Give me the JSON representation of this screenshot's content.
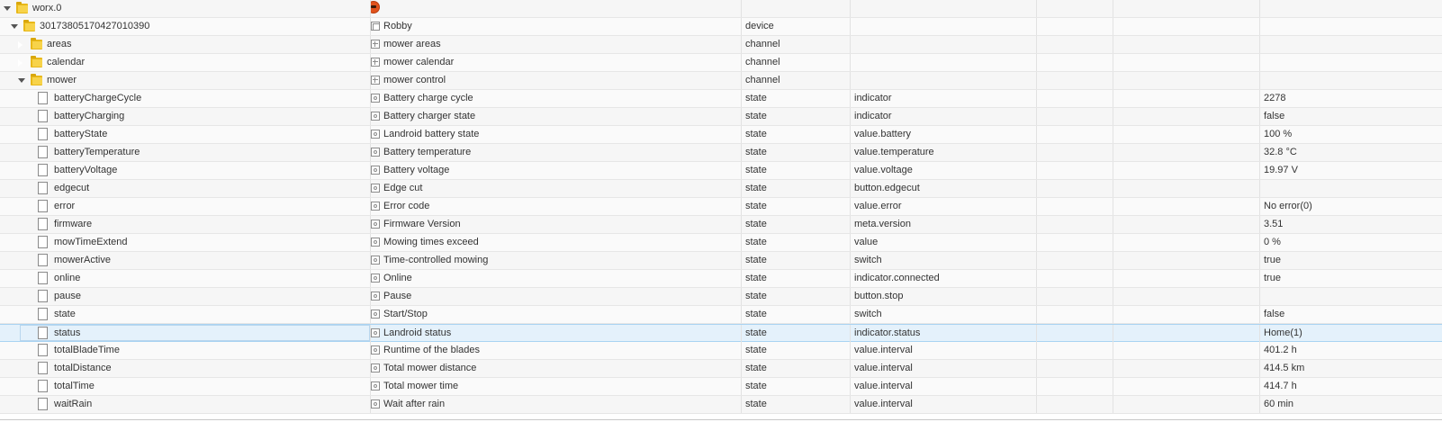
{
  "rows": [
    {
      "id": "worx.0",
      "name": "",
      "type": "",
      "role": "",
      "value": "",
      "level": 0,
      "kind": "folder",
      "twisty": "open",
      "logo": true
    },
    {
      "id": "30173805170427010390",
      "name": "Robby",
      "type": "device",
      "role": "",
      "value": "",
      "level": 1,
      "kind": "folder",
      "twisty": "open",
      "icon": "device"
    },
    {
      "id": "areas",
      "name": "mower areas",
      "type": "channel",
      "role": "",
      "value": "",
      "level": 2,
      "kind": "folder",
      "twisty": "closed",
      "icon": "channel"
    },
    {
      "id": "calendar",
      "name": "mower calendar",
      "type": "channel",
      "role": "",
      "value": "",
      "level": 2,
      "kind": "folder",
      "twisty": "closed",
      "icon": "channel"
    },
    {
      "id": "mower",
      "name": "mower control",
      "type": "channel",
      "role": "",
      "value": "",
      "level": 2,
      "kind": "folder",
      "twisty": "open",
      "icon": "channel"
    },
    {
      "id": "batteryChargeCycle",
      "name": "Battery charge cycle",
      "type": "state",
      "role": "indicator",
      "value": "2278",
      "level": 3,
      "kind": "file",
      "icon": "state"
    },
    {
      "id": "batteryCharging",
      "name": "Battery charger state",
      "type": "state",
      "role": "indicator",
      "value": "false",
      "level": 3,
      "kind": "file",
      "icon": "state"
    },
    {
      "id": "batteryState",
      "name": "Landroid battery state",
      "type": "state",
      "role": "value.battery",
      "value": "100 %",
      "level": 3,
      "kind": "file",
      "icon": "state"
    },
    {
      "id": "batteryTemperature",
      "name": "Battery temperature",
      "type": "state",
      "role": "value.temperature",
      "value": "32.8 °C",
      "level": 3,
      "kind": "file",
      "icon": "state"
    },
    {
      "id": "batteryVoltage",
      "name": "Battery voltage",
      "type": "state",
      "role": "value.voltage",
      "value": "19.97 V",
      "level": 3,
      "kind": "file",
      "icon": "state"
    },
    {
      "id": "edgecut",
      "name": "Edge cut",
      "type": "state",
      "role": "button.edgecut",
      "value": "",
      "level": 3,
      "kind": "file",
      "icon": "state"
    },
    {
      "id": "error",
      "name": "Error code",
      "type": "state",
      "role": "value.error",
      "value": "No error(0)",
      "level": 3,
      "kind": "file",
      "icon": "state"
    },
    {
      "id": "firmware",
      "name": "Firmware Version",
      "type": "state",
      "role": "meta.version",
      "value": "3.51",
      "level": 3,
      "kind": "file",
      "icon": "state"
    },
    {
      "id": "mowTimeExtend",
      "name": "Mowing times exceed",
      "type": "state",
      "role": "value",
      "value": "0 %",
      "level": 3,
      "kind": "file",
      "icon": "state"
    },
    {
      "id": "mowerActive",
      "name": "Time-controlled mowing",
      "type": "state",
      "role": "switch",
      "value": "true",
      "level": 3,
      "kind": "file",
      "icon": "state"
    },
    {
      "id": "online",
      "name": "Online",
      "type": "state",
      "role": "indicator.connected",
      "value": "true",
      "level": 3,
      "kind": "file",
      "icon": "state"
    },
    {
      "id": "pause",
      "name": "Pause",
      "type": "state",
      "role": "button.stop",
      "value": "",
      "level": 3,
      "kind": "file",
      "icon": "state"
    },
    {
      "id": "state",
      "name": "Start/Stop",
      "type": "state",
      "role": "switch",
      "value": "false",
      "level": 3,
      "kind": "file",
      "icon": "state"
    },
    {
      "id": "status",
      "name": "Landroid status",
      "type": "state",
      "role": "indicator.status",
      "value": "Home(1)",
      "level": 3,
      "kind": "file",
      "icon": "state",
      "selected": true
    },
    {
      "id": "totalBladeTime",
      "name": "Runtime of the blades",
      "type": "state",
      "role": "value.interval",
      "value": "401.2 h",
      "level": 3,
      "kind": "file",
      "icon": "state"
    },
    {
      "id": "totalDistance",
      "name": "Total mower distance",
      "type": "state",
      "role": "value.interval",
      "value": "414.5 km",
      "level": 3,
      "kind": "file",
      "icon": "state"
    },
    {
      "id": "totalTime",
      "name": "Total mower time",
      "type": "state",
      "role": "value.interval",
      "value": "414.7 h",
      "level": 3,
      "kind": "file",
      "icon": "state"
    },
    {
      "id": "waitRain",
      "name": "Wait after rain",
      "type": "state",
      "role": "value.interval",
      "value": "60 min",
      "level": 3,
      "kind": "file",
      "icon": "state"
    }
  ]
}
